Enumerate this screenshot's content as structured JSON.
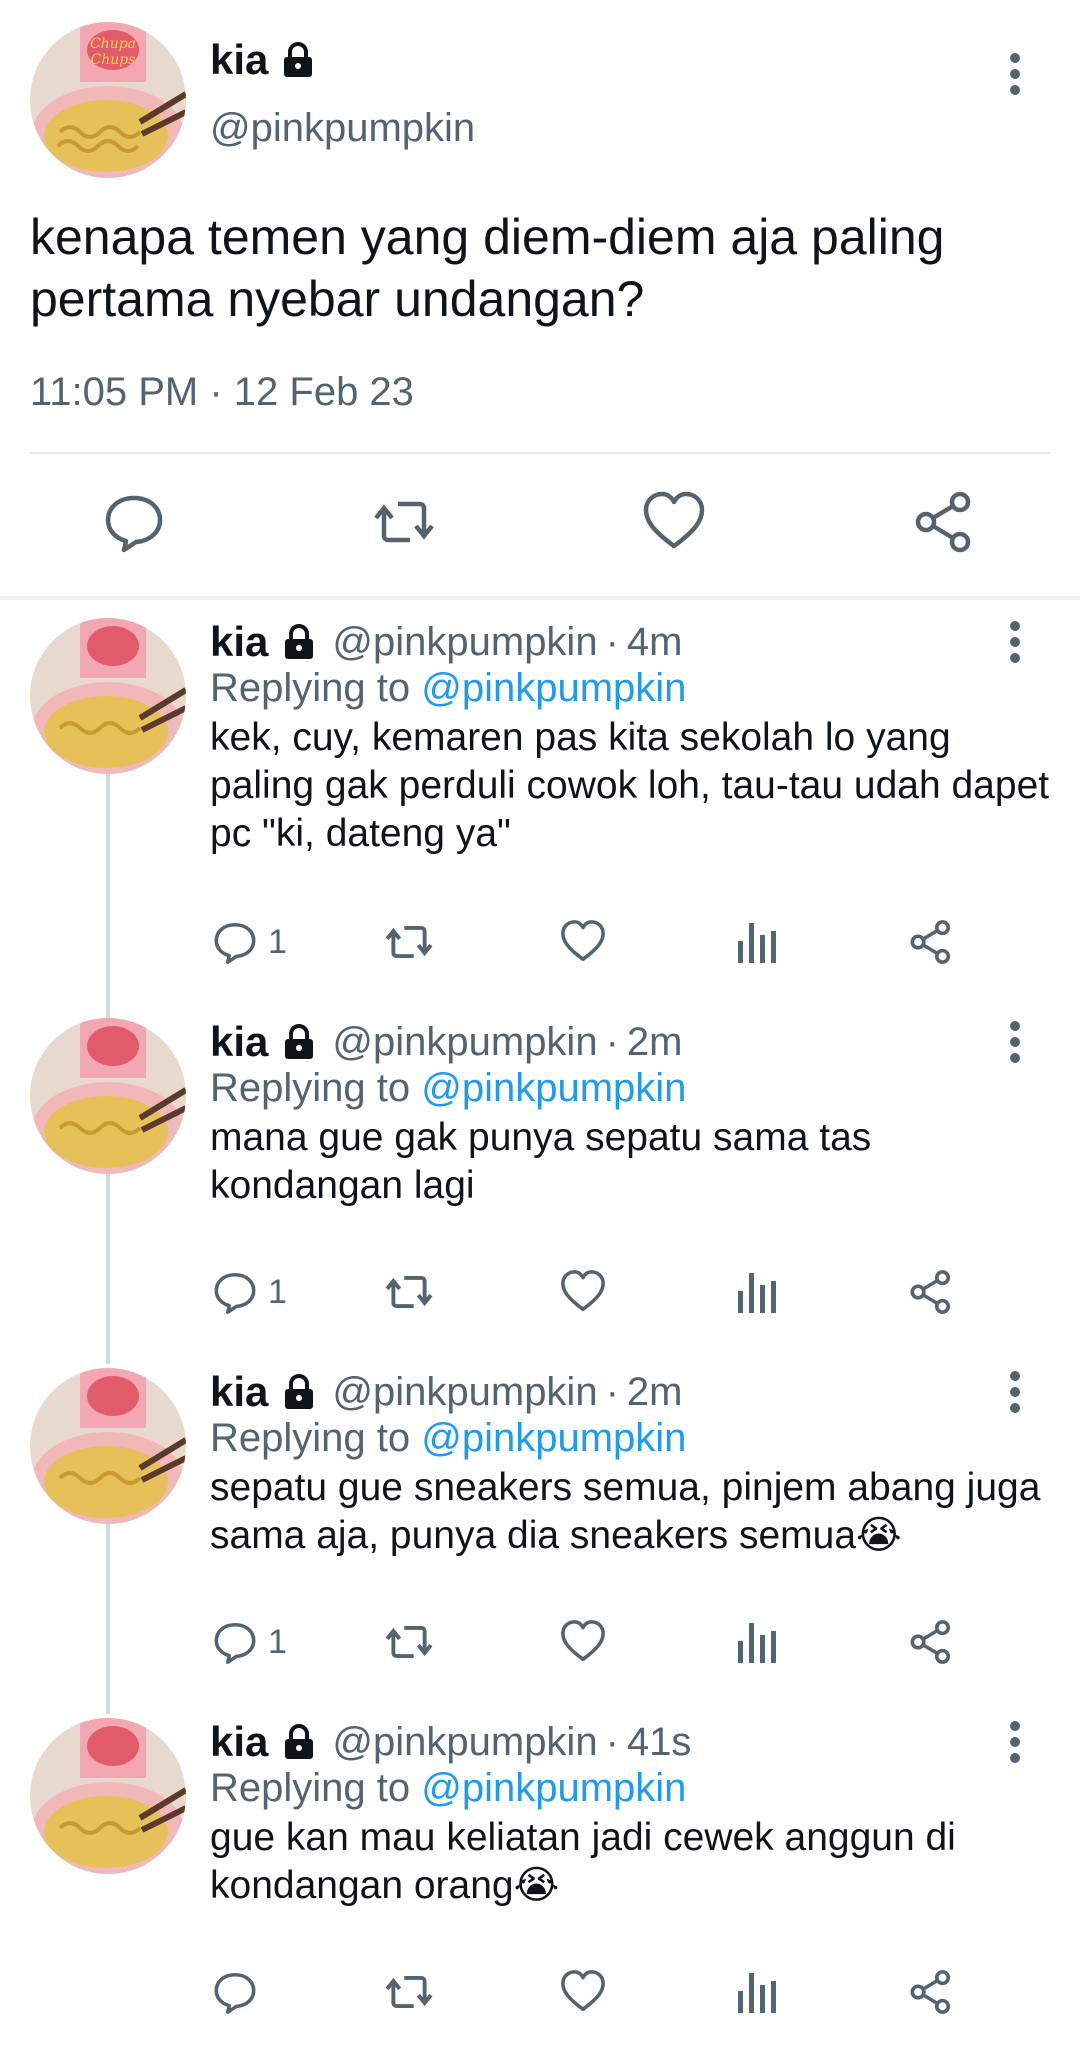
{
  "main_tweet": {
    "name": "kia",
    "handle": "@pinkpumpkin",
    "text": "kenapa temen yang diem-diem aja paling pertama nyebar undangan?",
    "timestamp": "11:05 PM · 12 Feb 23",
    "icons": [
      "reply-icon",
      "retweet-icon",
      "like-icon",
      "share-icon"
    ]
  },
  "replies": [
    {
      "name": "kia",
      "handle": "@pinkpumpkin",
      "dot": "·",
      "time": "4m",
      "replying_prefix": "Replying to",
      "replying_to": "@pinkpumpkin",
      "text": "kek, cuy, kemaren pas kita sekolah lo yang paling gak perduli cowok loh, tau-tau udah dapet pc \"ki, dateng ya\"",
      "reply_count": "1"
    },
    {
      "name": "kia",
      "handle": "@pinkpumpkin",
      "dot": "·",
      "time": "2m",
      "replying_prefix": "Replying to",
      "replying_to": "@pinkpumpkin",
      "text": "mana gue gak punya sepatu sama tas kondangan lagi",
      "reply_count": "1"
    },
    {
      "name": "kia",
      "handle": "@pinkpumpkin",
      "dot": "·",
      "time": "2m",
      "replying_prefix": "Replying to",
      "replying_to": "@pinkpumpkin",
      "text": "sepatu gue sneakers semua, pinjem abang juga sama aja, punya dia sneakers semua😭",
      "reply_count": "1"
    },
    {
      "name": "kia",
      "handle": "@pinkpumpkin",
      "dot": "·",
      "time": "41s",
      "replying_prefix": "Replying to",
      "replying_to": "@pinkpumpkin",
      "text": "gue kan mau keliatan jadi cewek anggun di kondangan orang😭",
      "reply_count": ""
    }
  ],
  "colors": {
    "text": "#0f1419",
    "secondary": "#536471",
    "accent": "#1d9bf0",
    "divider": "#e6e9ec"
  }
}
